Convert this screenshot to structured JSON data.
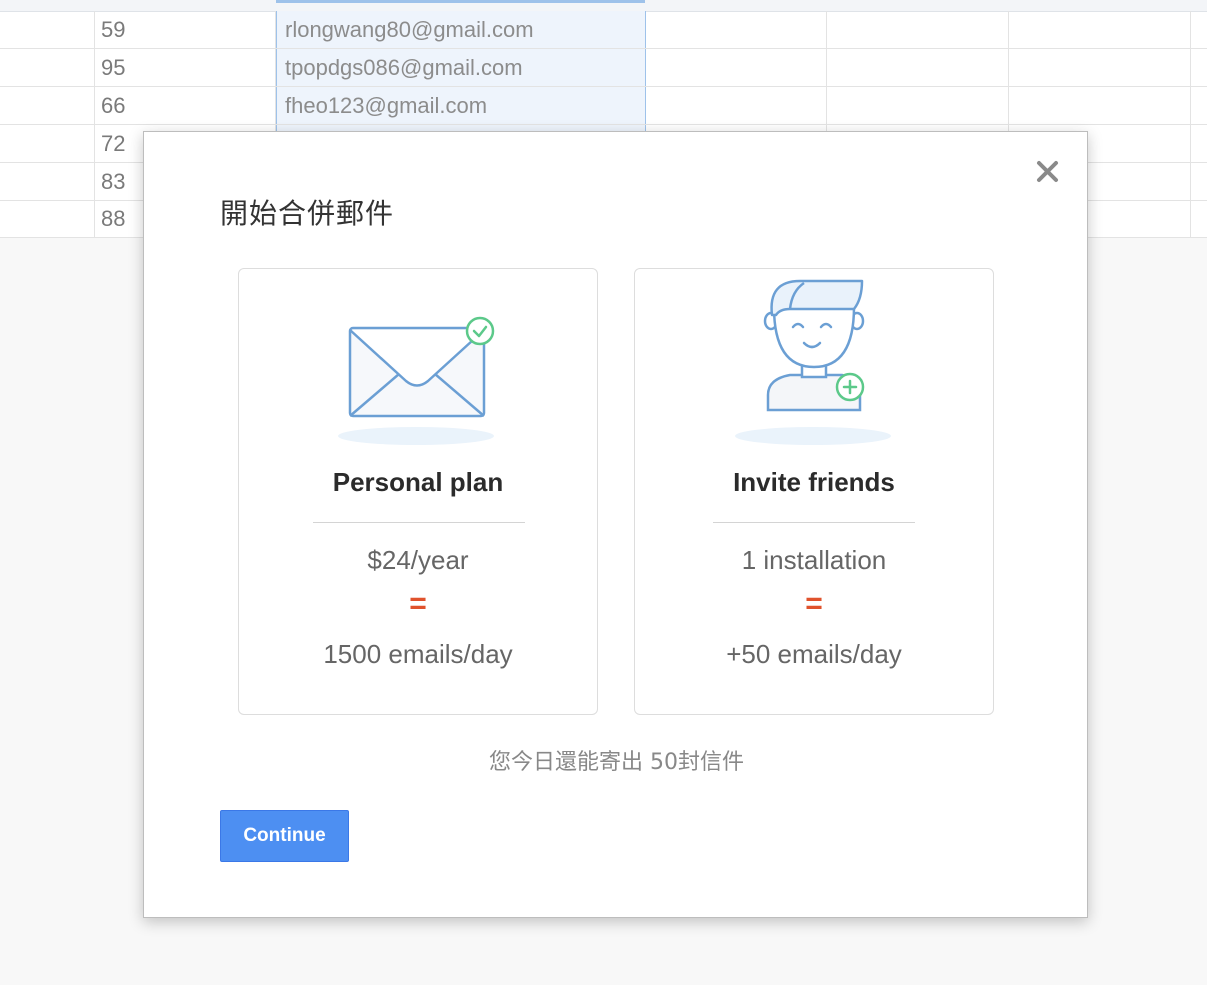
{
  "sheet": {
    "rows": [
      {
        "number": "59",
        "email": "rlongwang80@gmail.com"
      },
      {
        "number": "95",
        "email": "tpopdgs086@gmail.com"
      },
      {
        "number": "66",
        "email": "fheo123@gmail.com"
      },
      {
        "number": "72",
        "email": ""
      },
      {
        "number": "83",
        "email": ""
      },
      {
        "number": "88",
        "email": ""
      }
    ]
  },
  "dialog": {
    "title": "開始合併郵件",
    "close_icon": "close-icon",
    "cards": [
      {
        "icon": "envelope-check-icon",
        "heading": "Personal plan",
        "line1": "$24/year",
        "equals": "=",
        "line2": "1500 emails/day"
      },
      {
        "icon": "person-add-icon",
        "heading": "Invite friends",
        "line1": "1 installation",
        "equals": "=",
        "line2": "+50 emails/day"
      }
    ],
    "remaining_text": "您今日還能寄出 50封信件",
    "continue_label": "Continue"
  },
  "colors": {
    "accent_button": "#4d8ff2",
    "equals_sign": "#e0522c",
    "check_green": "#5cc98a",
    "illustration_blue": "#6b9fd4"
  }
}
